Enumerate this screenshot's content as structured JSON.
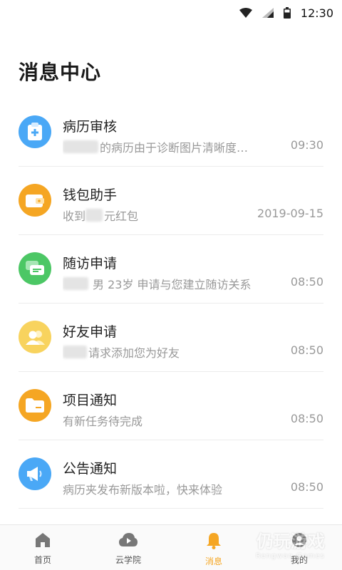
{
  "status_bar": {
    "time": "12:30"
  },
  "page": {
    "title": "消息中心"
  },
  "messages": [
    {
      "icon": "medical-record-icon",
      "color": "#4aa8f6",
      "title": "病历审核",
      "subtitle": "的病历由于诊断图片清晰度…",
      "time": "09:30"
    },
    {
      "icon": "wallet-icon",
      "color": "#f5a623",
      "title": "钱包助手",
      "subtitle_prefix": "收到",
      "subtitle": "元红包",
      "time": "2019-09-15"
    },
    {
      "icon": "chat-icon",
      "color": "#4cc765",
      "title": "随访申请",
      "subtitle": "男 23岁 申请与您建立随访关系",
      "time": "08:50"
    },
    {
      "icon": "friends-icon",
      "color": "#f8d35e",
      "title": "好友申请",
      "subtitle": "请求添加您为好友",
      "time": "08:50"
    },
    {
      "icon": "folder-icon",
      "color": "#f5a623",
      "title": "项目通知",
      "subtitle": "有新任务待完成",
      "time": "08:50"
    },
    {
      "icon": "megaphone-icon",
      "color": "#4aa8f6",
      "title": "公告通知",
      "subtitle": "病历夹发布新版本啦，快来体验",
      "time": "08:50"
    }
  ],
  "tabs": [
    {
      "label": "首页",
      "icon": "home-icon"
    },
    {
      "label": "云学院",
      "icon": "cloud-play-icon"
    },
    {
      "label": "消息",
      "icon": "bell-icon",
      "active": true
    },
    {
      "label": "我的",
      "icon": "profile-icon"
    }
  ],
  "watermark": {
    "main": "仍玩游戏",
    "sub": "Rengwan Games"
  },
  "colors": {
    "accent": "#f5a623",
    "muted_text": "#999999",
    "divider": "#ececec"
  }
}
